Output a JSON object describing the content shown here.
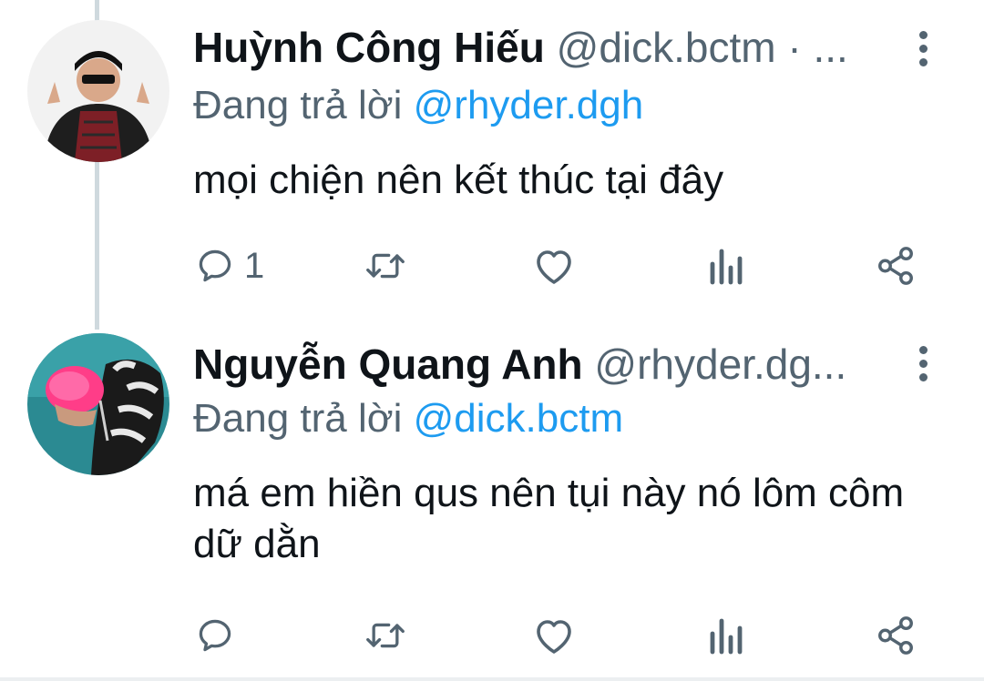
{
  "tweets": [
    {
      "name": "Huỳnh Công Hiếu",
      "handle": "@dick.bctm · ...",
      "reply_prefix": "Đang trả lời ",
      "reply_to": "@rhyder.dgh",
      "text": "mọi chiện nên kết thúc tại đây",
      "reply_count": "1",
      "avatar_icon": "avatar-photo"
    },
    {
      "name": "Nguyễn Quang Anh",
      "handle": "@rhyder.dg...",
      "reply_prefix": "Đang trả lời ",
      "reply_to": "@dick.bctm",
      "text": "má em hiền qus nên tụi này nó lôm côm dữ dằn",
      "reply_count": "",
      "avatar_icon": "avatar-photo"
    }
  ],
  "icons": {
    "reply": "reply-icon",
    "retweet": "retweet-icon",
    "like": "heart-icon",
    "views": "views-icon",
    "share": "share-icon",
    "more": "more-vertical-icon"
  },
  "colors": {
    "text": "#0f1419",
    "muted": "#536471",
    "mention": "#1d9bf0",
    "thread_line": "#cfd9de"
  }
}
